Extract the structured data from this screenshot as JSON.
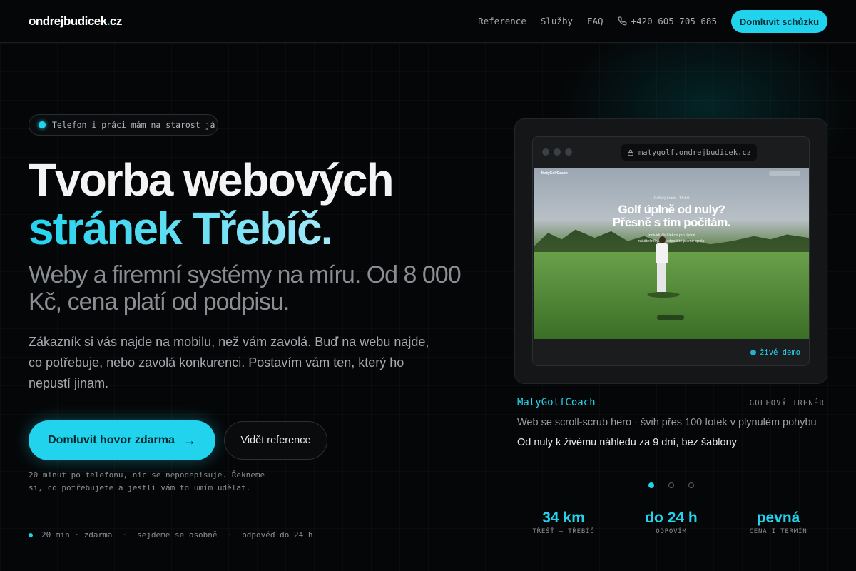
{
  "header": {
    "logo_main": "ondrejbudicek",
    "logo_dot": ".",
    "logo_tld": "cz",
    "nav": [
      {
        "label": "Reference"
      },
      {
        "label": "Služby"
      },
      {
        "label": "FAQ"
      }
    ],
    "phone": "+420 605 705 685",
    "cta": "Domluvit schůzku"
  },
  "hero": {
    "badge": "Telefon i práci mám na starost já",
    "title_line1": "Tvorba webových",
    "title_line2": "stránek Třebíč.",
    "subtitle": "Weby a firemní systémy na míru. Od 8 000 Kč, cena platí od podpisu.",
    "lead": "Zákazník si vás najde na mobilu, než vám zavolá. Buď na webu najde, co potřebuje, nebo zavolá konkurenci. Postavím vám ten, který ho nepustí jinam.",
    "primary_button": "Domluvit hovor zdarma",
    "primary_arrow": "→",
    "secondary_button": "Vidět reference",
    "note": "20 minut po telefonu, nic se nepodepisuje. Řekneme si, co potřebujete a jestli vám to umím udělat.",
    "meta": [
      "20 min · zdarma",
      "sejdeme se osobně",
      "odpověď do 24 h"
    ],
    "meta_sep": "·"
  },
  "showcase": {
    "url": "matygolf.ondrejbudicek.cz",
    "preview": {
      "nav_brand": "MatyGolfCoach",
      "kicker": "Golfový trenér · Třebíč",
      "headline_1": "Golf úplně od nuly?",
      "headline_2": "Přesně s tím počítám.",
      "sub_1": "Individuální lekce pro úplné",
      "sub_2": "začátečníky. Na odpaliště jdeme spolu."
    },
    "live_label": "živé demo",
    "client": "MatyGolfCoach",
    "role": "GOLFOVÝ TRENÉR",
    "desc_1": "Web se scroll-scrub hero · švih přes 100 fotek v plynulém pohybu",
    "desc_2": "Od nuly k živému náhledu za 9 dní, bez šablony",
    "slides_total": 3,
    "slide_active": 1,
    "accent": "#22d3ee"
  },
  "stats": [
    {
      "value": "34 km",
      "label": "TŘEŠŤ — TŘEBÍČ"
    },
    {
      "value": "do 24 h",
      "label": "ODPOVÍM"
    },
    {
      "value": "pevná",
      "label": "CENA I TERMÍN"
    }
  ]
}
